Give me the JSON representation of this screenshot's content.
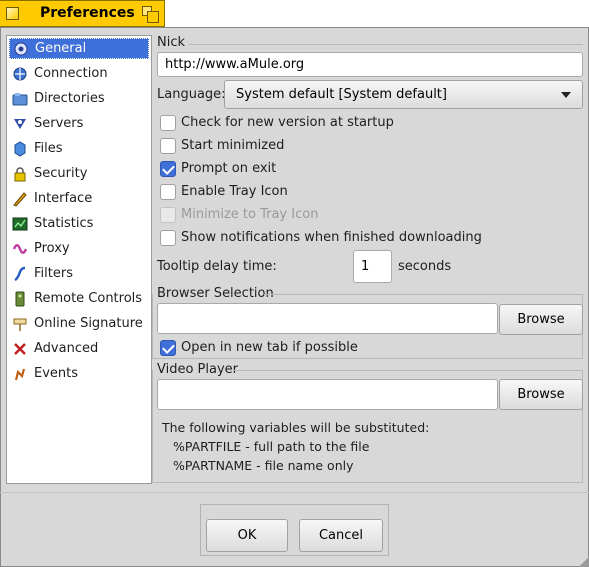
{
  "window": {
    "title": "Preferences"
  },
  "sidebar": {
    "items": [
      {
        "label": "General",
        "icon": "gear-icon"
      },
      {
        "label": "Connection",
        "icon": "connection-icon"
      },
      {
        "label": "Directories",
        "icon": "folder-icon"
      },
      {
        "label": "Servers",
        "icon": "servers-icon"
      },
      {
        "label": "Files",
        "icon": "files-icon"
      },
      {
        "label": "Security",
        "icon": "lock-icon"
      },
      {
        "label": "Interface",
        "icon": "interface-icon"
      },
      {
        "label": "Statistics",
        "icon": "statistics-icon"
      },
      {
        "label": "Proxy",
        "icon": "proxy-icon"
      },
      {
        "label": "Filters",
        "icon": "filter-icon"
      },
      {
        "label": "Remote Controls",
        "icon": "remote-icon"
      },
      {
        "label": "Online Signature",
        "icon": "signature-icon"
      },
      {
        "label": "Advanced",
        "icon": "advanced-icon"
      },
      {
        "label": "Events",
        "icon": "events-icon"
      }
    ]
  },
  "general": {
    "nick_label": "Nick",
    "nick_value": "http://www.aMule.org",
    "language_label": "Language:",
    "language_value": "System default [System default]",
    "checkboxes": [
      {
        "label": "Check for new version at startup",
        "checked": false,
        "enabled": true
      },
      {
        "label": "Start minimized",
        "checked": false,
        "enabled": true
      },
      {
        "label": "Prompt on exit",
        "checked": true,
        "enabled": true
      },
      {
        "label": "Enable Tray Icon",
        "checked": false,
        "enabled": true
      },
      {
        "label": "Minimize to Tray Icon",
        "checked": false,
        "enabled": false
      },
      {
        "label": "Show notifications when finished downloading",
        "checked": false,
        "enabled": true
      }
    ],
    "tooltip_label": "Tooltip delay time:",
    "tooltip_value": "1",
    "tooltip_unit": "seconds",
    "browser": {
      "group_label": "Browser Selection",
      "value": "",
      "browse_label": "Browse",
      "newtab_label": "Open in new tab if possible",
      "newtab_checked": true
    },
    "video": {
      "group_label": "Video Player",
      "value": "",
      "browse_label": "Browse",
      "note_lines": [
        "The following variables will be substituted:",
        "%PARTFILE - full path to the file",
        "%PARTNAME - file name only"
      ]
    }
  },
  "footer": {
    "ok_label": "OK",
    "cancel_label": "Cancel"
  },
  "colors": {
    "accent": "#3f6fd8",
    "title_tab": "#ffcb00",
    "window_bg": "#d8d8d8"
  }
}
